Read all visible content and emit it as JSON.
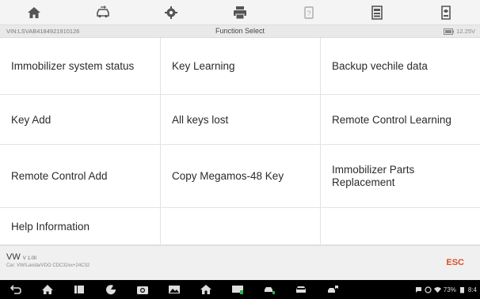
{
  "toolbar": {
    "buttons": [
      {
        "icon": "home-icon"
      },
      {
        "icon": "vehicle-swap-icon"
      },
      {
        "icon": "settings-icon"
      },
      {
        "icon": "print-icon"
      },
      {
        "icon": "help-icon"
      },
      {
        "icon": "save-icon"
      },
      {
        "icon": "data-log-icon"
      }
    ]
  },
  "info": {
    "vin": "VIN:LSVAB4184921910126",
    "title": "Function Select",
    "voltage": "12.25V"
  },
  "functions": [
    "Immobilizer system status",
    "Key Learning",
    "Backup vechile data",
    "Key Add",
    "All keys lost",
    "Remote Control Learning",
    "Remote Control Add",
    "Copy Megamos-48 Key",
    "Immobilizer Parts Replacement",
    "Help Information"
  ],
  "status": {
    "brand": "VW",
    "version": "V 1.00",
    "path": "Car: VW/Lavida/VDO CDC32xx+24C32",
    "esc": "ESC"
  },
  "tray": {
    "battery_pct": "73%",
    "time": "8:4"
  },
  "colors": {
    "accent": "#d9502b",
    "toolbar_bg": "#f4f4f4",
    "icon": "#555555"
  }
}
